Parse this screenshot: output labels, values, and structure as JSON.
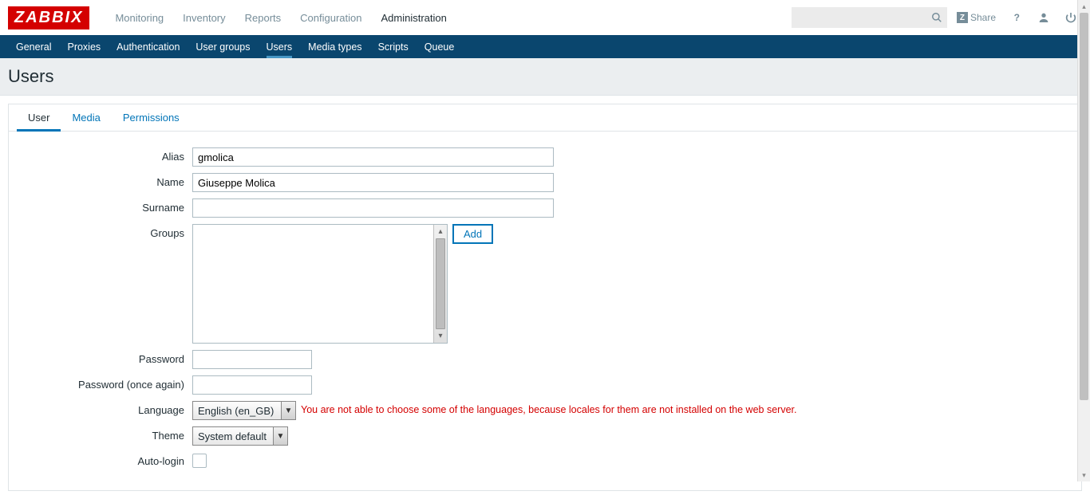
{
  "logo": "ZABBIX",
  "top_menu": [
    "Monitoring",
    "Inventory",
    "Reports",
    "Configuration",
    "Administration"
  ],
  "top_menu_active": 4,
  "share_label": "Share",
  "sub_menu": [
    "General",
    "Proxies",
    "Authentication",
    "User groups",
    "Users",
    "Media types",
    "Scripts",
    "Queue"
  ],
  "sub_menu_active": 4,
  "page_title": "Users",
  "tabs": [
    "User",
    "Media",
    "Permissions"
  ],
  "tabs_active": 0,
  "form": {
    "labels": {
      "alias": "Alias",
      "name": "Name",
      "surname": "Surname",
      "groups": "Groups",
      "password": "Password",
      "password2": "Password (once again)",
      "language": "Language",
      "theme": "Theme",
      "autologin": "Auto-login"
    },
    "values": {
      "alias": "gmolica",
      "name": "Giuseppe Molica",
      "surname": "",
      "password": "",
      "password2": "",
      "language": "English (en_GB)",
      "theme": "System default",
      "autologin": false
    },
    "add_btn": "Add",
    "lang_warning": "You are not able to choose some of the languages, because locales for them are not installed on the web server."
  }
}
